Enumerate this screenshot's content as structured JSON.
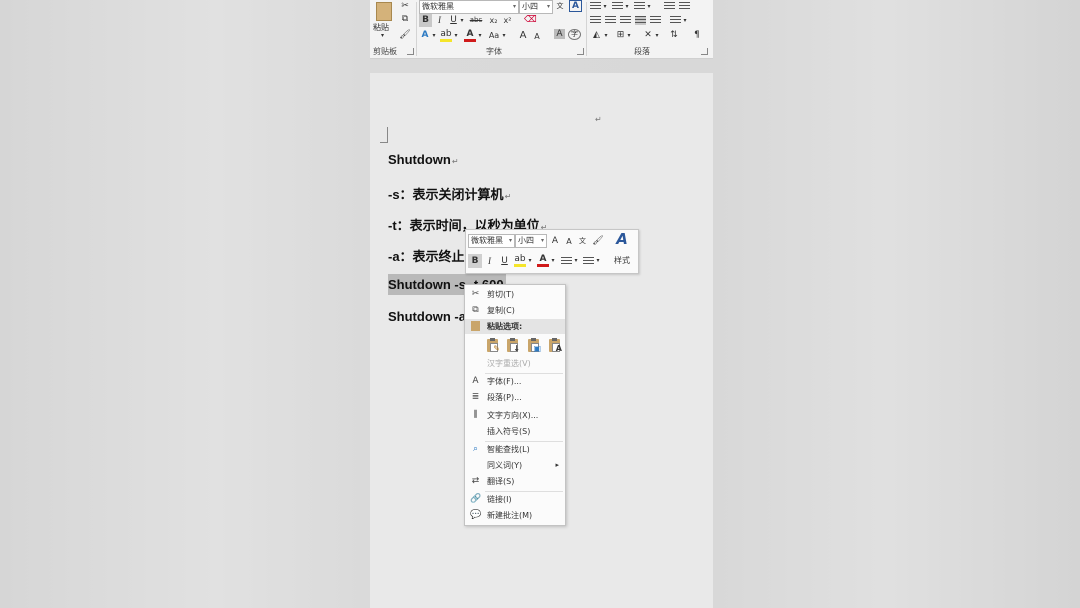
{
  "ribbon": {
    "clipboard": {
      "paste_label": "粘贴",
      "group_label": "剪贴板"
    },
    "font": {
      "font_name": "微软雅黑",
      "font_size": "小四",
      "bold": "B",
      "italic": "I",
      "underline": "U",
      "strike": "abc",
      "sub": "x₂",
      "sup": "x²",
      "grow": "A",
      "shrink": "A",
      "case": "Aa",
      "group_label": "字体"
    },
    "paragraph": {
      "group_label": "段落"
    }
  },
  "document": {
    "lines": [
      "Shutdown",
      "-s：表示关闭计算机",
      "-t：表示时间，以秒为单位",
      "-a：表示终止",
      "Shutdown -s -t 600",
      "Shutdown -a"
    ],
    "pilcrow": "↵"
  },
  "mini_toolbar": {
    "font_name": "微软雅黑",
    "font_size": "小四",
    "bold": "B",
    "italic": "I",
    "underline": "U",
    "font_color": "A",
    "styles_label": "样式"
  },
  "context_menu": {
    "cut": "剪切(T)",
    "copy": "复制(C)",
    "paste_options": "粘贴选项:",
    "hanzi_reconvert": "汉字重选(V)",
    "font": "字体(F)...",
    "paragraph": "段落(P)...",
    "text_direction": "文字方向(X)...",
    "insert_symbol": "插入符号(S)",
    "smart_lookup": "智能查找(L)",
    "synonyms": "同义词(Y)",
    "translate": "翻译(S)",
    "link": "链接(I)",
    "new_comment": "新建批注(M)"
  },
  "colors": {
    "highlight": "#f5e52a",
    "font_color": "#d01a1a",
    "accent": "#2b579a"
  }
}
